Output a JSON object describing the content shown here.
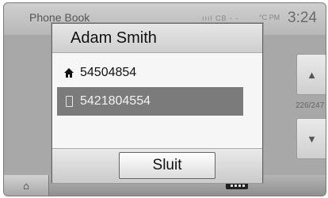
{
  "background": {
    "title": "Phone Book",
    "status_icons": "ıııl CB ‑ ‑",
    "temperature": "°C PM",
    "time": "3:24",
    "page_counter": "226/247"
  },
  "dialog": {
    "contact_name": "Adam Smith",
    "numbers": [
      {
        "type_icon": "home-icon",
        "value": "54504854",
        "selected": false
      },
      {
        "type_icon": "mobile-phone-icon",
        "value": "5421804554",
        "selected": true
      }
    ],
    "close_label": "Sluit"
  },
  "colors": {
    "dialog_bg": "#f6f6f6",
    "selected_row": "#7b7b7b",
    "screen_bg": "#a8a8a8"
  }
}
